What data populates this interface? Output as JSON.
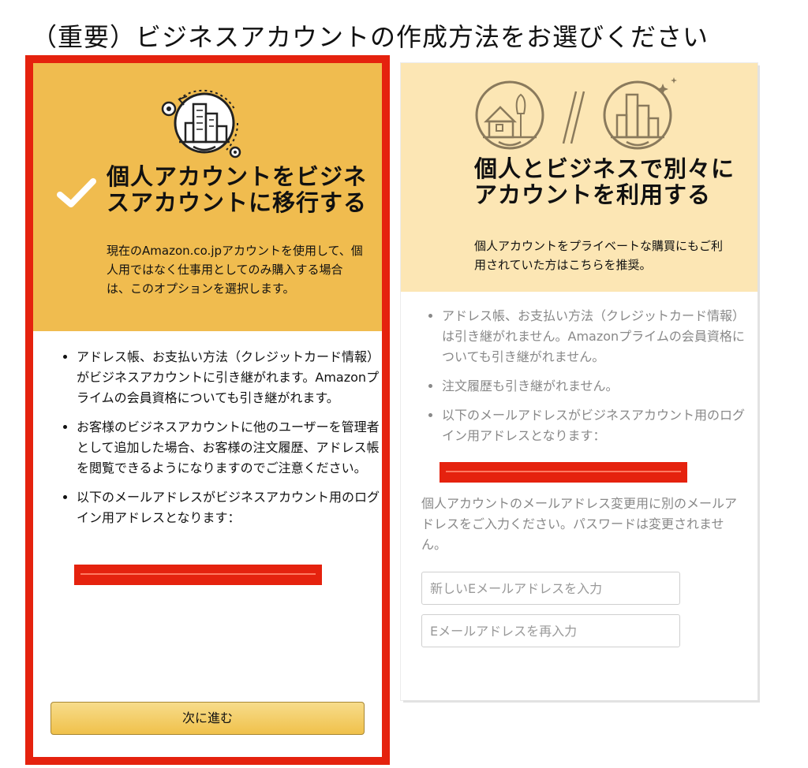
{
  "page": {
    "title": "（重要）ビジネスアカウントの作成方法をお選びください"
  },
  "option_convert": {
    "title": "個人アカウントをビジネスアカウントに移行する",
    "description": "現在のAmazon.co.jpアカウントを使用して、個人用ではなく仕事用としてのみ購入する場合は、このオプションを選択します。",
    "bullets": [
      "アドレス帳、お支払い方法（クレジットカード情報）がビジネスアカウントに引き継がれます。Amazonプライムの会員資格についても引き継がれます。",
      "お客様のビジネスアカウントに他のユーザーを管理者として追加した場合、お客様の注文履歴、アドレス帳を閲覧できるようになりますのでご注意ください。",
      "以下のメールアドレスがビジネスアカウント用のログイン用アドレスとなります："
    ],
    "next_button": "次に進む",
    "icon": "building-gear-icon",
    "selected_icon": "checkmark-icon"
  },
  "option_separate": {
    "title": "個人とビジネスで別々にアカウントを利用する",
    "description": "個人アカウントをプライベートな購買にもご利用されていた方はこちらを推奨。",
    "bullets": [
      "アドレス帳、お支払い方法（クレジットカード情報）は引き継がれません。Amazonプライムの会員資格についても引き継がれません。",
      "注文履歴も引き継がれません。",
      "以下のメールアドレスがビジネスアカウント用のログイン用アドレスとなります："
    ],
    "note": "個人アカウントのメールアドレス変更用に別のメールアドレスをご入力ください。パスワードは変更されません。",
    "new_email_placeholder": "新しいEメールアドレスを入力",
    "reenter_email_placeholder": "Eメールアドレスを再入力",
    "icons": [
      "house-icon",
      "building-icon"
    ]
  },
  "colors": {
    "selected_header": "#f0bc4f",
    "unselected_header": "#fce6b4",
    "selection_border": "#e5220e",
    "redaction": "#e5220e"
  }
}
